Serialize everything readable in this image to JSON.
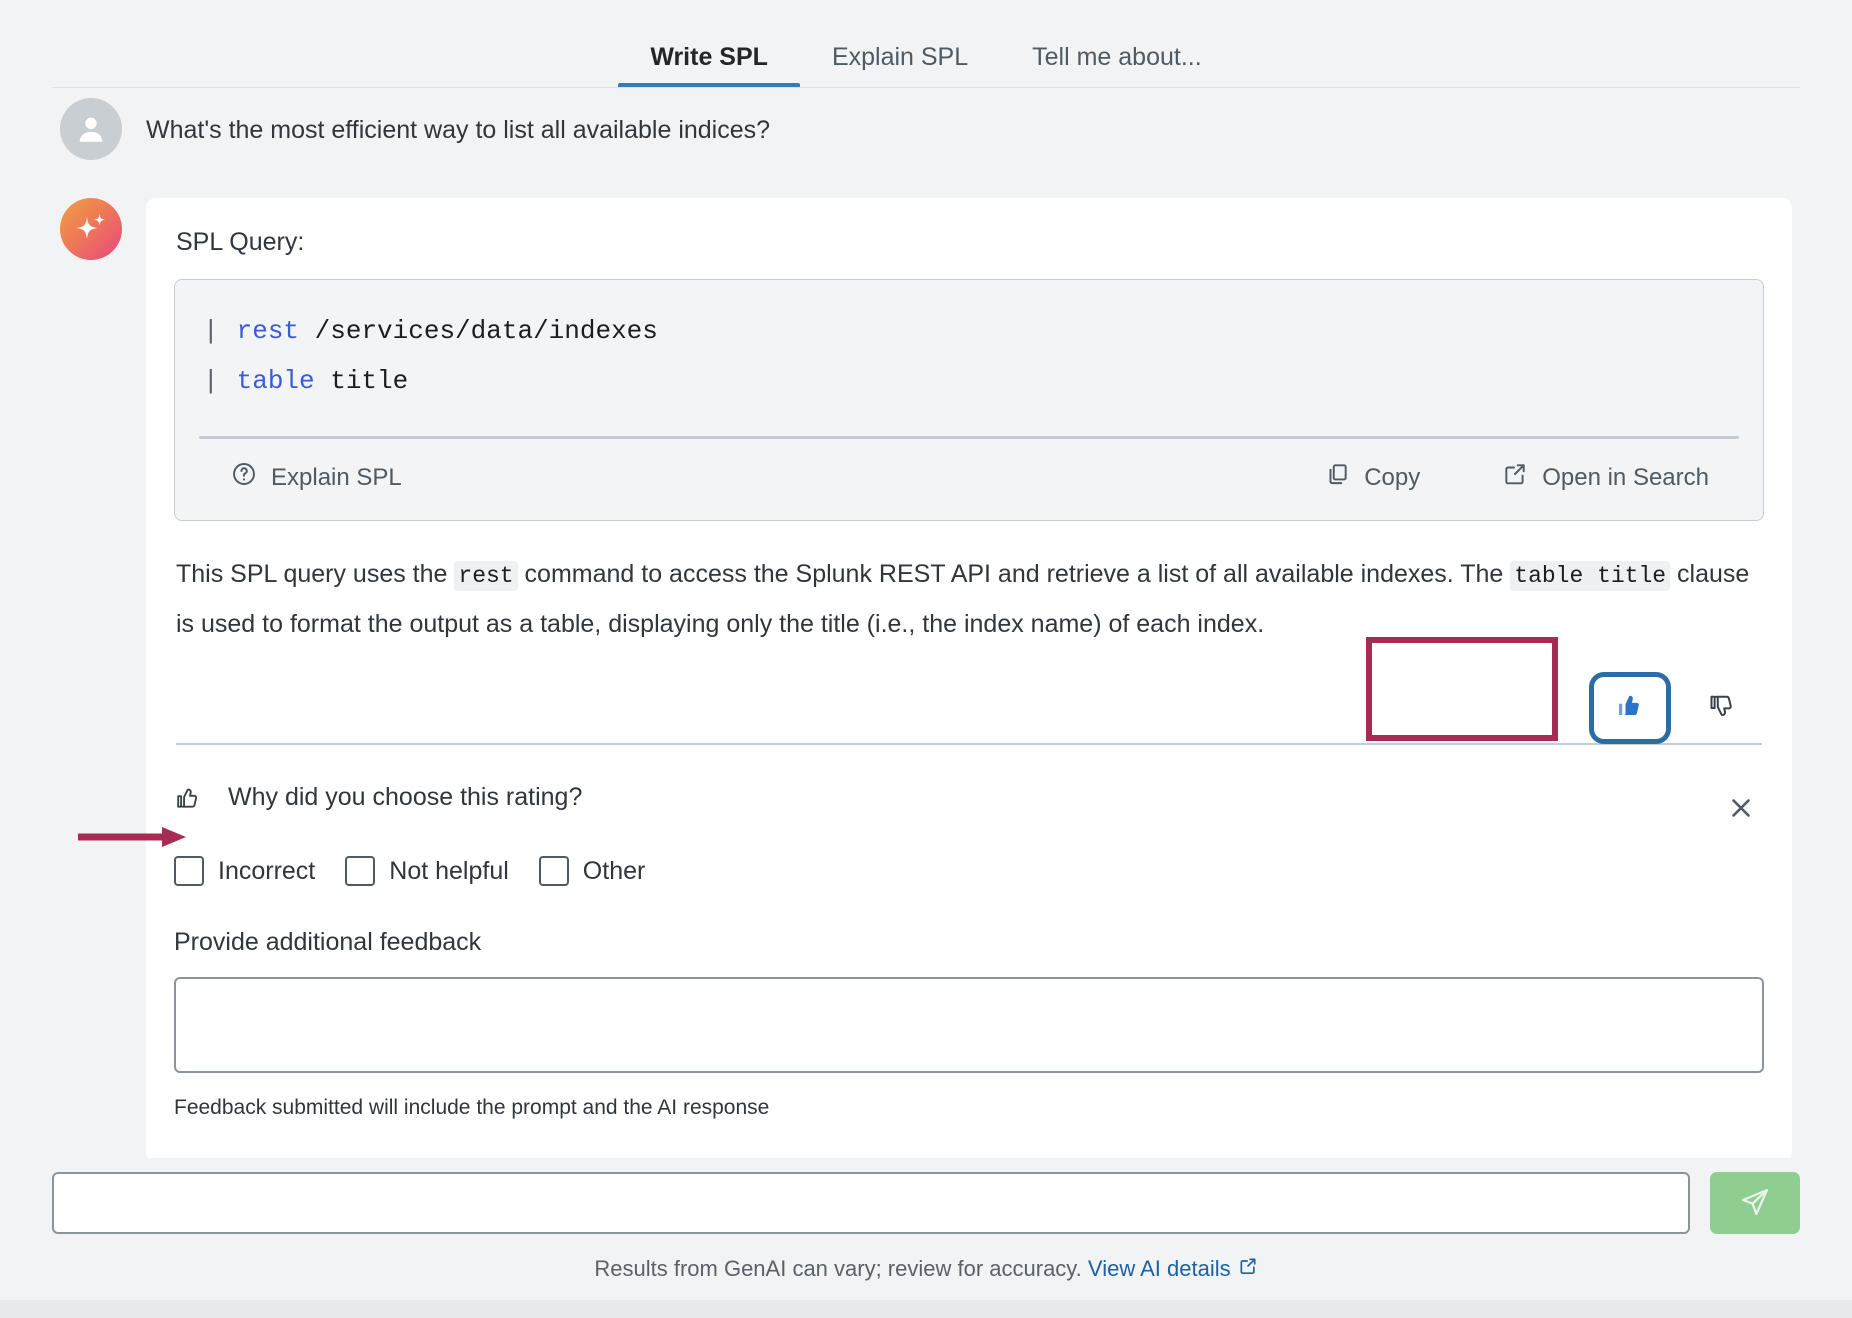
{
  "tabs": [
    {
      "label": "Write SPL",
      "active": true
    },
    {
      "label": "Explain SPL",
      "active": false
    },
    {
      "label": "Tell me about...",
      "active": false
    }
  ],
  "conversation": {
    "user_message": "What's the most efficient way to list all available indices?",
    "assistant": {
      "card_label": "SPL Query:",
      "code": {
        "lines": [
          {
            "pipe": "|",
            "keyword": "rest",
            "rest": " /services/data/indexes"
          },
          {
            "pipe": "|",
            "keyword": "table",
            "rest": " title"
          }
        ],
        "actions": {
          "explain_label": "Explain SPL",
          "copy_label": "Copy",
          "open_label": "Open in Search"
        }
      },
      "explanation": {
        "part1": "This SPL query uses the ",
        "code1": "rest",
        "part2": " command to access the Splunk REST API and retrieve a list of all available indexes. The ",
        "code2": "table title",
        "part3": " clause is used to format the output as a table, displaying only the title (i.e., the index name) of each index."
      }
    }
  },
  "rating": {
    "thumbs_up_selected": true,
    "thumbs_down_selected": false,
    "highlight_color": "#a82b54",
    "selected_outline_color": "#2c6ca3",
    "thumb_up_fill": "#3a7ab3"
  },
  "feedback": {
    "question": "Why did you choose this rating?",
    "close_label": "✕",
    "options": [
      {
        "label": "Incorrect",
        "checked": false
      },
      {
        "label": "Not helpful",
        "checked": false
      },
      {
        "label": "Other",
        "checked": false
      }
    ],
    "additional_label": "Provide additional feedback",
    "textarea_value": "",
    "textarea_placeholder": "",
    "note": "Feedback submitted will include the prompt and the AI response"
  },
  "composer": {
    "input_value": "",
    "input_placeholder": "",
    "send_icon": "paper-plane-icon",
    "send_color": "#8fcd90"
  },
  "footer": {
    "disclaimer": "Results from GenAI can vary; review for accuracy.",
    "link_label": "View AI details"
  },
  "icons": {
    "user": "user-avatar-icon",
    "ai": "ai-sparkle-icon",
    "help": "question-circle-icon",
    "copy": "copy-icon",
    "external": "external-link-icon",
    "thumb_up": "thumbs-up-icon",
    "thumb_down": "thumbs-down-icon",
    "close": "close-icon"
  }
}
